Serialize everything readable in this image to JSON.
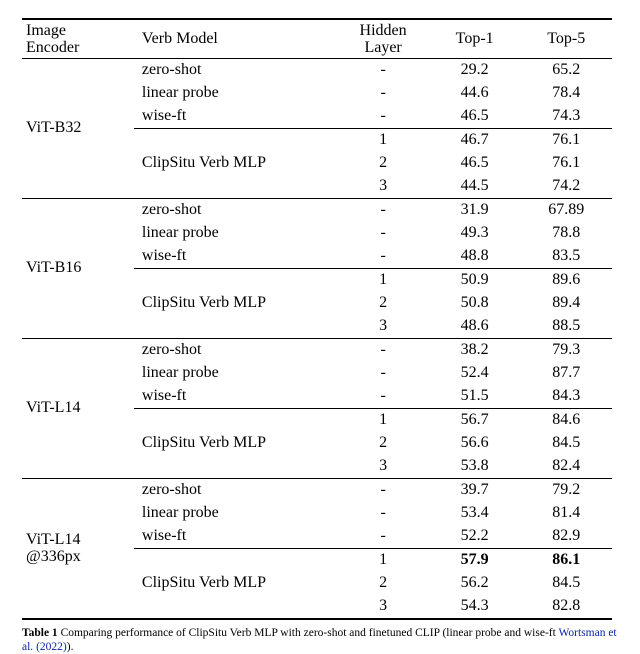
{
  "headers": {
    "encoder_l1": "Image",
    "encoder_l2": "Encoder",
    "verb_model": "Verb Model",
    "hidden_l1": "Hidden",
    "hidden_l2": "Layer",
    "top1": "Top-1",
    "top5": "Top-5"
  },
  "model_labels": {
    "zero_shot": "zero-shot",
    "linear_probe": "linear probe",
    "wise_ft": "wise-ft",
    "clipsitu": "ClipSitu Verb MLP"
  },
  "groups": [
    {
      "encoder": "ViT-B32",
      "rows": [
        {
          "model_key": "zero_shot",
          "hidden": "-",
          "top1": "29.2",
          "top5": "65.2"
        },
        {
          "model_key": "linear_probe",
          "hidden": "-",
          "top1": "44.6",
          "top5": "78.4"
        },
        {
          "model_key": "wise_ft",
          "hidden": "-",
          "top1": "46.5",
          "top5": "74.3"
        }
      ],
      "mlp": [
        {
          "hidden": "1",
          "top1": "46.7",
          "top5": "76.1"
        },
        {
          "hidden": "2",
          "top1": "46.5",
          "top5": "76.1"
        },
        {
          "hidden": "3",
          "top1": "44.5",
          "top5": "74.2"
        }
      ]
    },
    {
      "encoder": "ViT-B16",
      "rows": [
        {
          "model_key": "zero_shot",
          "hidden": "-",
          "top1": "31.9",
          "top5": "67.89"
        },
        {
          "model_key": "linear_probe",
          "hidden": "-",
          "top1": "49.3",
          "top5": "78.8"
        },
        {
          "model_key": "wise_ft",
          "hidden": "-",
          "top1": "48.8",
          "top5": "83.5"
        }
      ],
      "mlp": [
        {
          "hidden": "1",
          "top1": "50.9",
          "top5": "89.6"
        },
        {
          "hidden": "2",
          "top1": "50.8",
          "top5": "89.4"
        },
        {
          "hidden": "3",
          "top1": "48.6",
          "top5": "88.5"
        }
      ]
    },
    {
      "encoder": "ViT-L14",
      "rows": [
        {
          "model_key": "zero_shot",
          "hidden": "-",
          "top1": "38.2",
          "top5": "79.3"
        },
        {
          "model_key": "linear_probe",
          "hidden": "-",
          "top1": "52.4",
          "top5": "87.7"
        },
        {
          "model_key": "wise_ft",
          "hidden": "-",
          "top1": "51.5",
          "top5": "84.3"
        }
      ],
      "mlp": [
        {
          "hidden": "1",
          "top1": "56.7",
          "top5": "84.6"
        },
        {
          "hidden": "2",
          "top1": "56.6",
          "top5": "84.5"
        },
        {
          "hidden": "3",
          "top1": "53.8",
          "top5": "82.4"
        }
      ]
    },
    {
      "encoder": "ViT-L14\n@336px",
      "rows": [
        {
          "model_key": "zero_shot",
          "hidden": "-",
          "top1": "39.7",
          "top5": "79.2"
        },
        {
          "model_key": "linear_probe",
          "hidden": "-",
          "top1": "53.4",
          "top5": "81.4"
        },
        {
          "model_key": "wise_ft",
          "hidden": "-",
          "top1": "52.2",
          "top5": "82.9"
        }
      ],
      "mlp": [
        {
          "hidden": "1",
          "top1": "57.9",
          "top5": "86.1",
          "bold": true
        },
        {
          "hidden": "2",
          "top1": "56.2",
          "top5": "84.5"
        },
        {
          "hidden": "3",
          "top1": "54.3",
          "top5": "82.8"
        }
      ]
    }
  ],
  "caption": {
    "label": "Table 1",
    "text_a": "  Comparing performance of ClipSitu Verb MLP with zero-shot and finetuned CLIP (linear probe and wise-ft ",
    "cite": "Wortsman et al.",
    "year": " (2022)",
    "text_b": ")."
  },
  "chart_data": {
    "type": "table",
    "title": "Comparing performance of ClipSitu Verb MLP with zero-shot and finetuned CLIP",
    "columns": [
      "Image Encoder",
      "Verb Model",
      "Hidden Layer",
      "Top-1",
      "Top-5"
    ],
    "rows": [
      [
        "ViT-B32",
        "zero-shot",
        "-",
        29.2,
        65.2
      ],
      [
        "ViT-B32",
        "linear probe",
        "-",
        44.6,
        78.4
      ],
      [
        "ViT-B32",
        "wise-ft",
        "-",
        46.5,
        74.3
      ],
      [
        "ViT-B32",
        "ClipSitu Verb MLP",
        1,
        46.7,
        76.1
      ],
      [
        "ViT-B32",
        "ClipSitu Verb MLP",
        2,
        46.5,
        76.1
      ],
      [
        "ViT-B32",
        "ClipSitu Verb MLP",
        3,
        44.5,
        74.2
      ],
      [
        "ViT-B16",
        "zero-shot",
        "-",
        31.9,
        67.89
      ],
      [
        "ViT-B16",
        "linear probe",
        "-",
        49.3,
        78.8
      ],
      [
        "ViT-B16",
        "wise-ft",
        "-",
        48.8,
        83.5
      ],
      [
        "ViT-B16",
        "ClipSitu Verb MLP",
        1,
        50.9,
        89.6
      ],
      [
        "ViT-B16",
        "ClipSitu Verb MLP",
        2,
        50.8,
        89.4
      ],
      [
        "ViT-B16",
        "ClipSitu Verb MLP",
        3,
        48.6,
        88.5
      ],
      [
        "ViT-L14",
        "zero-shot",
        "-",
        38.2,
        79.3
      ],
      [
        "ViT-L14",
        "linear probe",
        "-",
        52.4,
        87.7
      ],
      [
        "ViT-L14",
        "wise-ft",
        "-",
        51.5,
        84.3
      ],
      [
        "ViT-L14",
        "ClipSitu Verb MLP",
        1,
        56.7,
        84.6
      ],
      [
        "ViT-L14",
        "ClipSitu Verb MLP",
        2,
        56.6,
        84.5
      ],
      [
        "ViT-L14",
        "ClipSitu Verb MLP",
        3,
        53.8,
        82.4
      ],
      [
        "ViT-L14 @336px",
        "zero-shot",
        "-",
        39.7,
        79.2
      ],
      [
        "ViT-L14 @336px",
        "linear probe",
        "-",
        53.4,
        81.4
      ],
      [
        "ViT-L14 @336px",
        "wise-ft",
        "-",
        52.2,
        82.9
      ],
      [
        "ViT-L14 @336px",
        "ClipSitu Verb MLP",
        1,
        57.9,
        86.1
      ],
      [
        "ViT-L14 @336px",
        "ClipSitu Verb MLP",
        2,
        56.2,
        84.5
      ],
      [
        "ViT-L14 @336px",
        "ClipSitu Verb MLP",
        3,
        54.3,
        82.8
      ]
    ]
  }
}
